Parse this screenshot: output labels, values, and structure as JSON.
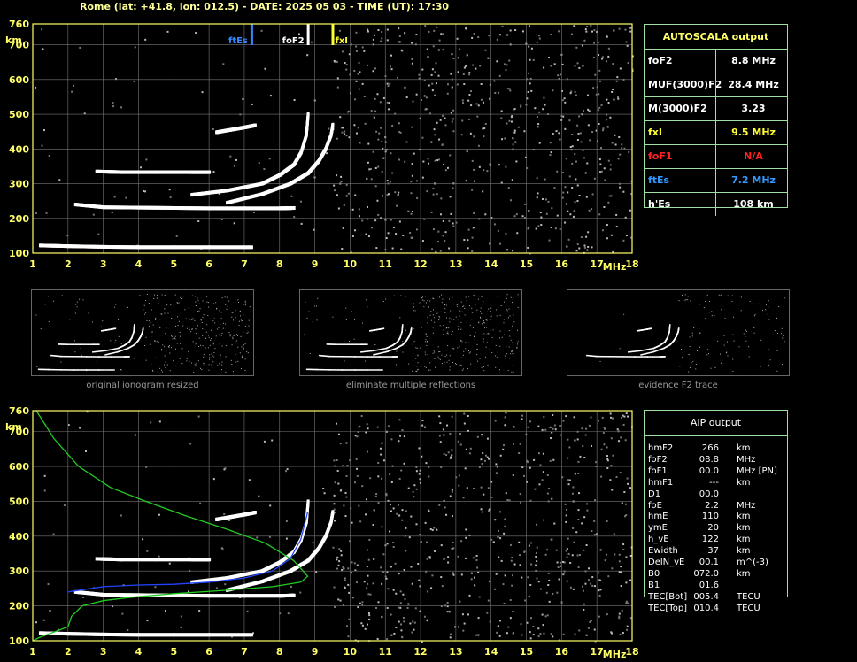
{
  "header": {
    "title": "Rome (lat: +41.8, lon: 012.5) - DATE: 2025 05 03 - TIME (UT): 17:30"
  },
  "chart_data": [
    {
      "type": "scatter",
      "title": "",
      "xlabel": "MHz",
      "ylabel": "km",
      "xlim": [
        1,
        18
      ],
      "ylim": [
        100,
        760
      ],
      "xticks": [
        "1",
        "2",
        "3",
        "4",
        "5",
        "6",
        "7",
        "8",
        "9",
        "10",
        "11",
        "12",
        "13",
        "14",
        "15",
        "16",
        "17",
        "18"
      ],
      "yticks": [
        "100",
        "200",
        "300",
        "400",
        "500",
        "600",
        "700",
        "760"
      ],
      "grid": true,
      "markers": [
        {
          "name": "ftEs",
          "x": 7.2,
          "color": "#3388ff"
        },
        {
          "name": "foF2",
          "x": 8.8,
          "color": "#ffffff"
        },
        {
          "name": "fxI",
          "x": 9.5,
          "color": "#ffff33"
        }
      ],
      "traces": [
        {
          "x": [
            1.2,
            2.0,
            3.0,
            4.0,
            5.0,
            6.0,
            7.2
          ],
          "y": [
            122,
            120,
            118,
            117,
            117,
            117,
            117
          ]
        },
        {
          "x": [
            2.2,
            3.0,
            4.0,
            5.0,
            6.0,
            7.0,
            8.0,
            8.4
          ],
          "y": [
            240,
            232,
            231,
            230,
            229,
            229,
            229,
            230
          ]
        },
        {
          "x": [
            2.8,
            3.5,
            4.5,
            5.5,
            6.0
          ],
          "y": [
            335,
            333,
            333,
            333,
            333
          ]
        },
        {
          "x": [
            5.5,
            6.5,
            7.5,
            8.0,
            8.4,
            8.6,
            8.75,
            8.8
          ],
          "y": [
            268,
            280,
            300,
            325,
            355,
            390,
            440,
            500
          ]
        },
        {
          "x": [
            6.5,
            7.5,
            8.3,
            8.8,
            9.1,
            9.3,
            9.45,
            9.5
          ],
          "y": [
            245,
            270,
            300,
            330,
            365,
            400,
            440,
            470
          ]
        },
        {
          "x": [
            6.2,
            6.6,
            7.0,
            7.3
          ],
          "y": [
            448,
            455,
            462,
            468
          ]
        }
      ]
    },
    {
      "type": "line",
      "title": "",
      "xlabel": "MHz",
      "ylabel": "km",
      "xlim": [
        1,
        18
      ],
      "ylim": [
        100,
        760
      ],
      "xticks": [
        "1",
        "2",
        "3",
        "4",
        "5",
        "6",
        "7",
        "8",
        "9",
        "10",
        "11",
        "12",
        "13",
        "14",
        "15",
        "16",
        "17",
        "18"
      ],
      "yticks": [
        "100",
        "200",
        "300",
        "400",
        "500",
        "600",
        "700",
        "760"
      ],
      "grid": true,
      "series": [
        {
          "color": "#22cc22",
          "x": [
            1.1,
            1.6,
            2.3,
            3.2,
            4.2,
            5.3,
            6.5,
            7.6,
            8.4,
            8.8,
            8.6,
            7.8,
            6.5,
            5.0,
            3.8,
            3.0,
            2.4,
            2.1,
            2.0,
            1.6,
            1.2,
            1.0
          ],
          "y": [
            760,
            680,
            600,
            540,
            500,
            460,
            420,
            380,
            330,
            285,
            268,
            255,
            245,
            235,
            225,
            215,
            200,
            170,
            140,
            125,
            110,
            100
          ]
        },
        {
          "color": "#2244ff",
          "x": [
            2.0,
            3.0,
            4.0,
            5.0,
            6.0,
            7.0,
            7.8,
            8.3,
            8.6,
            8.8
          ],
          "y": [
            240,
            255,
            260,
            262,
            268,
            280,
            300,
            335,
            390,
            470
          ]
        }
      ],
      "traces": [
        {
          "x": [
            1.2,
            2.0,
            3.0,
            4.0,
            5.0,
            6.0,
            7.2
          ],
          "y": [
            122,
            120,
            118,
            117,
            117,
            117,
            117
          ]
        },
        {
          "x": [
            2.2,
            3.0,
            4.0,
            5.0,
            6.0,
            7.0,
            8.0,
            8.4
          ],
          "y": [
            240,
            232,
            231,
            230,
            229,
            229,
            229,
            230
          ]
        },
        {
          "x": [
            2.8,
            3.5,
            4.5,
            5.5,
            6.0
          ],
          "y": [
            335,
            333,
            333,
            333,
            333
          ]
        },
        {
          "x": [
            5.5,
            6.5,
            7.5,
            8.0,
            8.4,
            8.6,
            8.75,
            8.8
          ],
          "y": [
            268,
            280,
            300,
            325,
            355,
            390,
            440,
            500
          ]
        },
        {
          "x": [
            6.5,
            7.5,
            8.3,
            8.8,
            9.1,
            9.3,
            9.45,
            9.5
          ],
          "y": [
            245,
            270,
            300,
            330,
            365,
            400,
            440,
            470
          ]
        },
        {
          "x": [
            6.2,
            6.6,
            7.0,
            7.3
          ],
          "y": [
            448,
            455,
            462,
            468
          ]
        }
      ]
    }
  ],
  "autoscala": {
    "header": "AUTOSCALA output",
    "rows": [
      {
        "label": "foF2",
        "value": "8.8 MHz",
        "color": "#ffffff"
      },
      {
        "label": "MUF(3000)F2",
        "value": "28.4 MHz",
        "color": "#ffffff"
      },
      {
        "label": "M(3000)F2",
        "value": "3.23",
        "color": "#ffffff"
      },
      {
        "label": "fxI",
        "value": "9.5 MHz",
        "color": "#ffff33"
      },
      {
        "label": "foF1",
        "value": "N/A",
        "color": "#ff2222"
      },
      {
        "label": "ftEs",
        "value": "7.2 MHz",
        "color": "#3399ff"
      },
      {
        "label": "h'Es",
        "value": "108    km",
        "color": "#ffffff"
      }
    ]
  },
  "thumbnails": [
    {
      "caption": "original ionogram resized"
    },
    {
      "caption": "eliminate multiple reflections"
    },
    {
      "caption": "evidence F2 trace"
    }
  ],
  "aip": {
    "header": "AIP output",
    "rows": [
      {
        "name": "hmF2",
        "value": "266",
        "unit": "km"
      },
      {
        "name": "foF2",
        "value": "08.8",
        "unit": "MHz"
      },
      {
        "name": "foF1",
        "value": "00.0",
        "unit": "MHz  [PN]"
      },
      {
        "name": "hmF1",
        "value": "---",
        "unit": "km"
      },
      {
        "name": "D1",
        "value": "00.0",
        "unit": ""
      },
      {
        "name": "foE",
        "value": "2.2",
        "unit": "MHz"
      },
      {
        "name": "hmE",
        "value": "110",
        "unit": "km"
      },
      {
        "name": "ymE",
        "value": "20",
        "unit": "km"
      },
      {
        "name": "h_vE",
        "value": "122",
        "unit": "km"
      },
      {
        "name": "Ewidth",
        "value": "37",
        "unit": "km"
      },
      {
        "name": "DelN_vE",
        "value": "00.1",
        "unit": "m^(-3)"
      },
      {
        "name": "B0",
        "value": "072.0",
        "unit": "km"
      },
      {
        "name": "B1",
        "value": "01.6",
        "unit": ""
      },
      {
        "name": "TEC[Bot]",
        "value": "005.4",
        "unit": "TECU"
      },
      {
        "name": "TEC[Top]",
        "value": "010.4",
        "unit": "TECU"
      }
    ]
  }
}
